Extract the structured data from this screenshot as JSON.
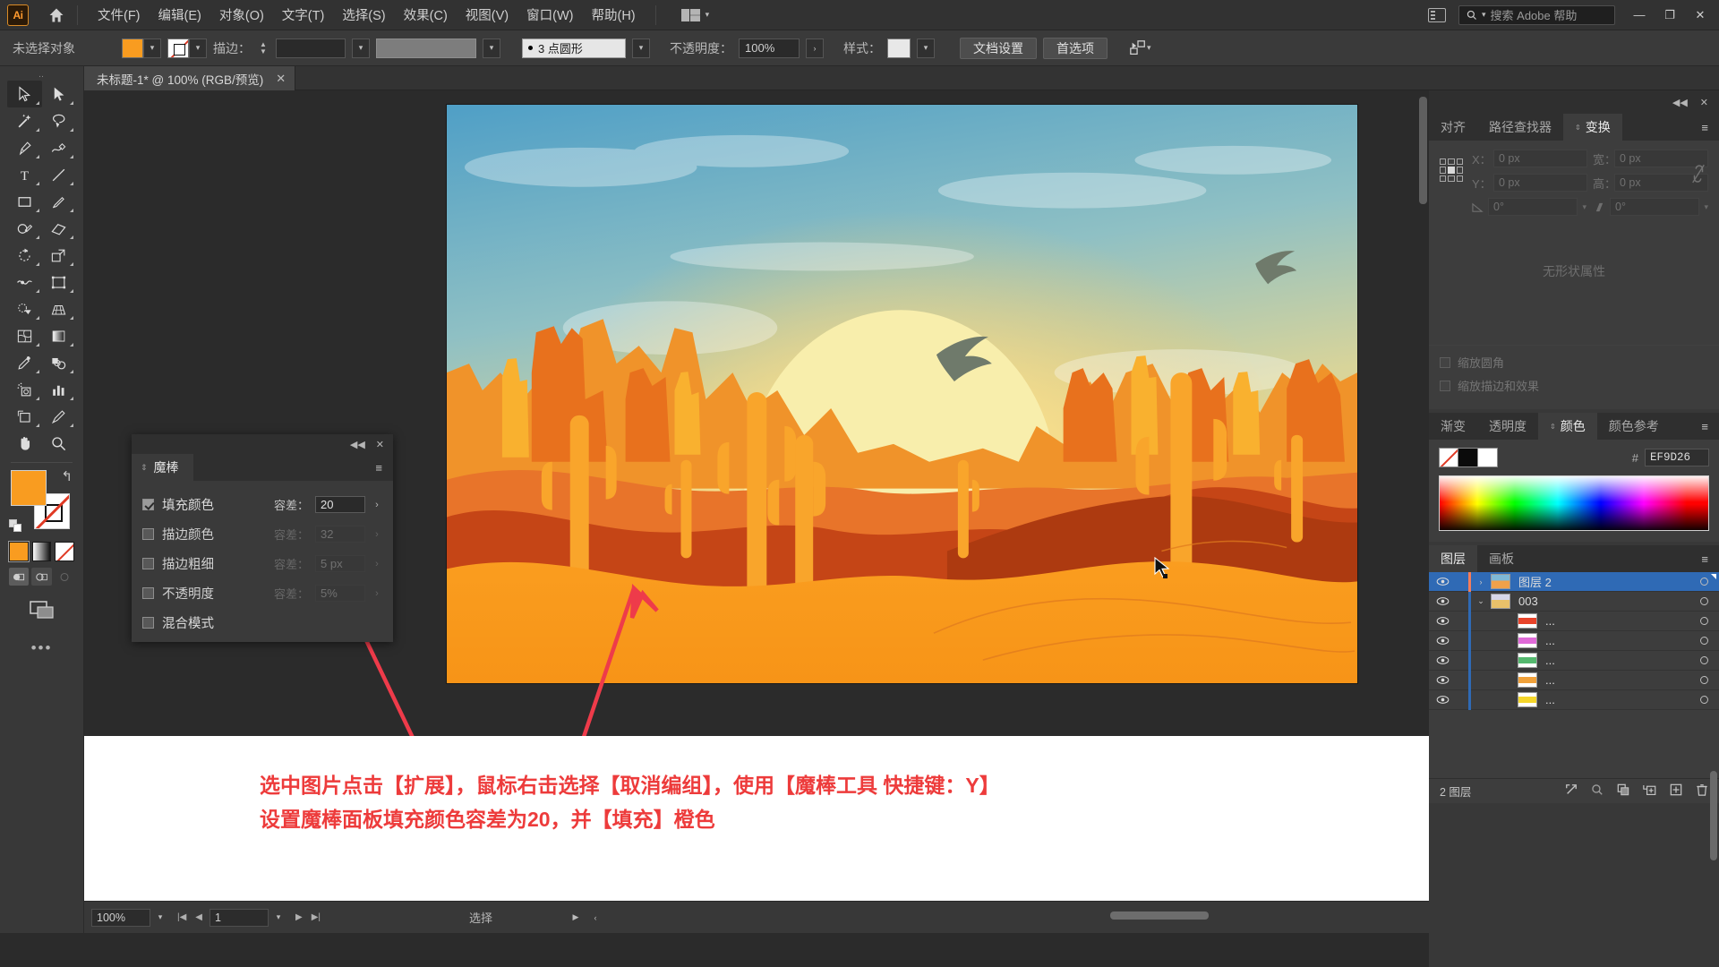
{
  "app": {
    "logo_text": "Ai",
    "menus": [
      "文件(F)",
      "编辑(E)",
      "对象(O)",
      "文字(T)",
      "选择(S)",
      "效果(C)",
      "视图(V)",
      "窗口(W)",
      "帮助(H)"
    ],
    "workspace_label": "",
    "search_placeholder": "搜索 Adobe 帮助",
    "window_buttons": [
      "—",
      "❐",
      "✕"
    ]
  },
  "control_bar": {
    "selection_status": "未选择对象",
    "fill_color": "#F99C20",
    "stroke_color": "none",
    "stroke_label": "描边：",
    "stroke_weight": "",
    "stroke_profile": "",
    "stroke_style": "3 点圆形",
    "opacity_label": "不透明度：",
    "opacity_value": "100%",
    "style_label": "样式：",
    "doc_setup_button": "文档设置",
    "preferences_button": "首选项"
  },
  "document_tab": {
    "title": "未标题-1* @ 100% (RGB/预览)",
    "close": "✕"
  },
  "toolbar": {
    "tools": [
      "selection-tool",
      "direct-selection-tool",
      "magic-wand-tool",
      "lasso-tool",
      "pen-tool",
      "curvature-tool",
      "type-tool",
      "line-segment-tool",
      "rectangle-tool",
      "paintbrush-tool",
      "shaper-tool",
      "eraser-tool",
      "rotate-tool",
      "scale-tool",
      "width-tool",
      "free-transform-tool",
      "shape-builder-tool",
      "perspective-grid-tool",
      "mesh-tool",
      "gradient-tool",
      "eyedropper-tool",
      "blend-tool",
      "symbol-sprayer-tool",
      "column-graph-tool",
      "artboard-tool",
      "slice-tool",
      "hand-tool",
      "zoom-tool"
    ],
    "fill_swatch": "#F99C20",
    "stroke_swatch": "none",
    "dots": "•••"
  },
  "magic_wand_panel": {
    "title": "魔棒",
    "collapse": "◀◀",
    "close": "✕",
    "menu": "≡",
    "rows": [
      {
        "label": "填充颜色",
        "checked": true,
        "tolerance_label": "容差：",
        "tolerance_value": "20",
        "enabled": true
      },
      {
        "label": "描边颜色",
        "checked": false,
        "tolerance_label": "容差：",
        "tolerance_value": "32",
        "enabled": false
      },
      {
        "label": "描边粗细",
        "checked": false,
        "tolerance_label": "容差：",
        "tolerance_value": "5 px",
        "enabled": false
      },
      {
        "label": "不透明度",
        "checked": false,
        "tolerance_label": "容差：",
        "tolerance_value": "5%",
        "enabled": false
      },
      {
        "label": "混合模式",
        "checked": false,
        "tolerance_label": "",
        "tolerance_value": "",
        "enabled": false
      }
    ]
  },
  "transform_panel": {
    "collapse": "◀◀",
    "close": "✕",
    "tabs": [
      "对齐",
      "路径查找器",
      "变换"
    ],
    "active_tab": "变换",
    "menu": "≡",
    "x_label": "X：",
    "x_value": "0 px",
    "y_label": "Y：",
    "y_value": "0 px",
    "w_label": "宽：",
    "w_value": "0 px",
    "h_label": "高：",
    "h_value": "0 px",
    "rotate_value": "0°",
    "shear_value": "0°",
    "no_shape_props": "无形状属性",
    "scale_corners": "缩放圆角",
    "scale_strokes": "缩放描边和效果"
  },
  "color_panel": {
    "tabs": [
      "渐变",
      "透明度",
      "颜色",
      "颜色参考"
    ],
    "active_tab": "颜色",
    "menu": "≡",
    "hex_symbol": "#",
    "hex_value": "EF9D26"
  },
  "layers_panel": {
    "tabs": [
      "图层",
      "画板"
    ],
    "active_tab": "图层",
    "menu": "≡",
    "rows": [
      {
        "name": "图层 2",
        "selected": true,
        "indent": 0,
        "twisty": "›",
        "color": "#f47c5a",
        "thumb_a": "#f0a14a",
        "thumb_b": "#7fb8d6"
      },
      {
        "name": "003",
        "selected": false,
        "indent": 0,
        "twisty": "⌄",
        "color": "#2f6ab5",
        "thumb_a": "#e8c06a",
        "thumb_b": "#d7d7e8"
      },
      {
        "name": "...",
        "selected": false,
        "indent": 1,
        "twisty": "",
        "color": "#2f6ab5",
        "thumb_a": "#e8432a",
        "thumb_b": "#ffffff"
      },
      {
        "name": "...",
        "selected": false,
        "indent": 1,
        "twisty": "",
        "color": "#2f6ab5",
        "thumb_a": "#e06ad8",
        "thumb_b": "#ffffff"
      },
      {
        "name": "...",
        "selected": false,
        "indent": 1,
        "twisty": "",
        "color": "#2f6ab5",
        "thumb_a": "#54b86e",
        "thumb_b": "#ffffff"
      },
      {
        "name": "...",
        "selected": false,
        "indent": 1,
        "twisty": "",
        "color": "#2f6ab5",
        "thumb_a": "#f0a13a",
        "thumb_b": "#ffffff"
      },
      {
        "name": "...",
        "selected": false,
        "indent": 1,
        "twisty": "",
        "color": "#2f6ab5",
        "thumb_a": "#f5d62a",
        "thumb_b": "#ffffff"
      }
    ],
    "footer_count": "2 图层",
    "footer_icons": [
      "locate-object-icon",
      "search-layers-icon",
      "duplicate-layer-icon",
      "new-sublayer-icon",
      "new-layer-icon",
      "delete-layer-icon"
    ]
  },
  "annotation": {
    "line1": "选中图片点击【扩展】，鼠标右击选择【取消编组】，使用【魔棒工具 快捷键：Y】",
    "line2": "设置魔棒面板填充颜色容差为20，并【填充】橙色",
    "color": "#ED3B3B"
  },
  "status_bar": {
    "zoom": "100%",
    "page": "1",
    "status_text": "选择",
    "nav_first": "|◀",
    "nav_prev": "◀",
    "nav_next": "▶",
    "nav_last": "▶|"
  },
  "artwork": {
    "description": "desert-sunset-illustration",
    "sky_top": "#5aa6c8",
    "sun_color": "#f7efad",
    "sand_color": "#f79a21",
    "mesa_color": "#e8641c",
    "dune_shadow": "#c23d14"
  }
}
